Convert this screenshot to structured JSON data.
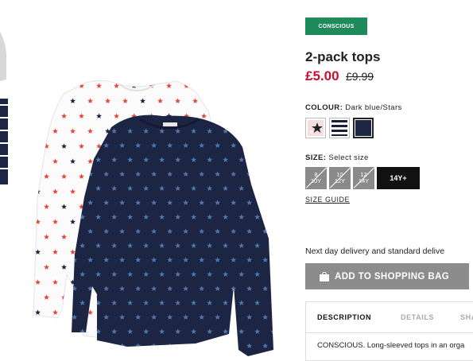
{
  "product": {
    "badge": "CONSCIOUS",
    "title": "2-pack tops",
    "price_now": "£5.00",
    "price_was": "£9.99"
  },
  "colour": {
    "label": "COLOUR:",
    "selected": "Dark blue/Stars",
    "swatches": [
      "pink-stars",
      "navy-white-stripes",
      "dark-blue-stars"
    ]
  },
  "size": {
    "label": "SIZE:",
    "placeholder": "Select size",
    "options": [
      {
        "line1": "8",
        "line2": "10Y",
        "available": false
      },
      {
        "line1": "10",
        "line2": "12Y",
        "available": false
      },
      {
        "line1": "12",
        "line2": "14Y",
        "available": false
      },
      {
        "line1": "14Y+",
        "line2": "",
        "available": true
      }
    ],
    "guide_label": "SIZE GUIDE"
  },
  "delivery_text": "Next day delivery and standard delive",
  "add_to_bag_label": "ADD TO SHOPPING BAG",
  "tabs": [
    {
      "label": "DESCRIPTION",
      "active": true
    },
    {
      "label": "DETAILS",
      "active": false
    },
    {
      "label": "SHA",
      "active": false
    }
  ],
  "description_text": "CONSCIOUS. Long-sleeved tops in an orga",
  "colors": {
    "badge": "#1f8a5b",
    "sale_price": "#c8102e",
    "navy_top": "#1d2545",
    "star_blue": "#4f76a8",
    "star_red": "#e14b3b",
    "button_disabled": "#8c8c8c"
  },
  "icons": [
    "shopping-bag-icon",
    "star-icon"
  ]
}
